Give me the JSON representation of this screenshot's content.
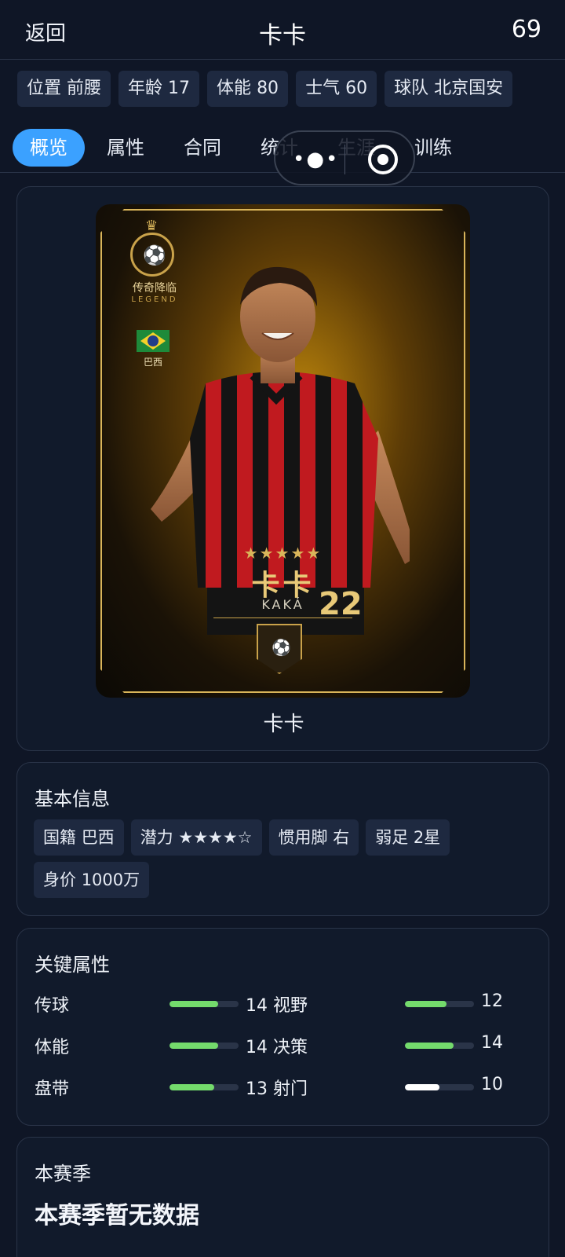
{
  "header": {
    "back_label": "返回",
    "title": "卡卡",
    "rating": "69"
  },
  "chips": [
    {
      "label": "位置",
      "value": "前腰"
    },
    {
      "label": "年龄",
      "value": "17"
    },
    {
      "label": "体能",
      "value": "80"
    },
    {
      "label": "士气",
      "value": "60"
    },
    {
      "label": "球队",
      "value": "北京国安"
    }
  ],
  "tabs": [
    "概览",
    "属性",
    "合同",
    "统计",
    "生涯",
    "训练"
  ],
  "active_tab": "概览",
  "accent_color": "#3ba1ff",
  "player_card": {
    "badge_cn": "传奇降临",
    "badge_en": "LEGEND",
    "flag_label": "巴西",
    "stars": "★★★★★",
    "name_cn": "卡卡",
    "name_en": "KAKÁ",
    "number": "22",
    "caption": "卡卡"
  },
  "basic_info": {
    "title": "基本信息",
    "items": [
      {
        "label": "国籍",
        "value": "巴西"
      },
      {
        "label": "潜力",
        "value": "★★★★☆"
      },
      {
        "label": "惯用脚",
        "value": "右"
      },
      {
        "label": "弱足",
        "value": "2星"
      },
      {
        "label": "身价",
        "value": "1000万"
      }
    ]
  },
  "key_attributes": {
    "title": "关键属性",
    "max": 20,
    "rows": [
      {
        "left": {
          "name": "传球",
          "value": 14,
          "color": "#74db6c"
        },
        "right": {
          "name": "视野",
          "value": 12,
          "color": "#74db6c"
        }
      },
      {
        "left": {
          "name": "体能",
          "value": 14,
          "color": "#74db6c"
        },
        "right": {
          "name": "决策",
          "value": 14,
          "color": "#74db6c"
        }
      },
      {
        "left": {
          "name": "盘带",
          "value": 13,
          "color": "#74db6c"
        },
        "right": {
          "name": "射门",
          "value": 10,
          "color": "#ffffff"
        }
      }
    ]
  },
  "season": {
    "title": "本赛季",
    "empty_text": "本赛季暂无数据"
  }
}
